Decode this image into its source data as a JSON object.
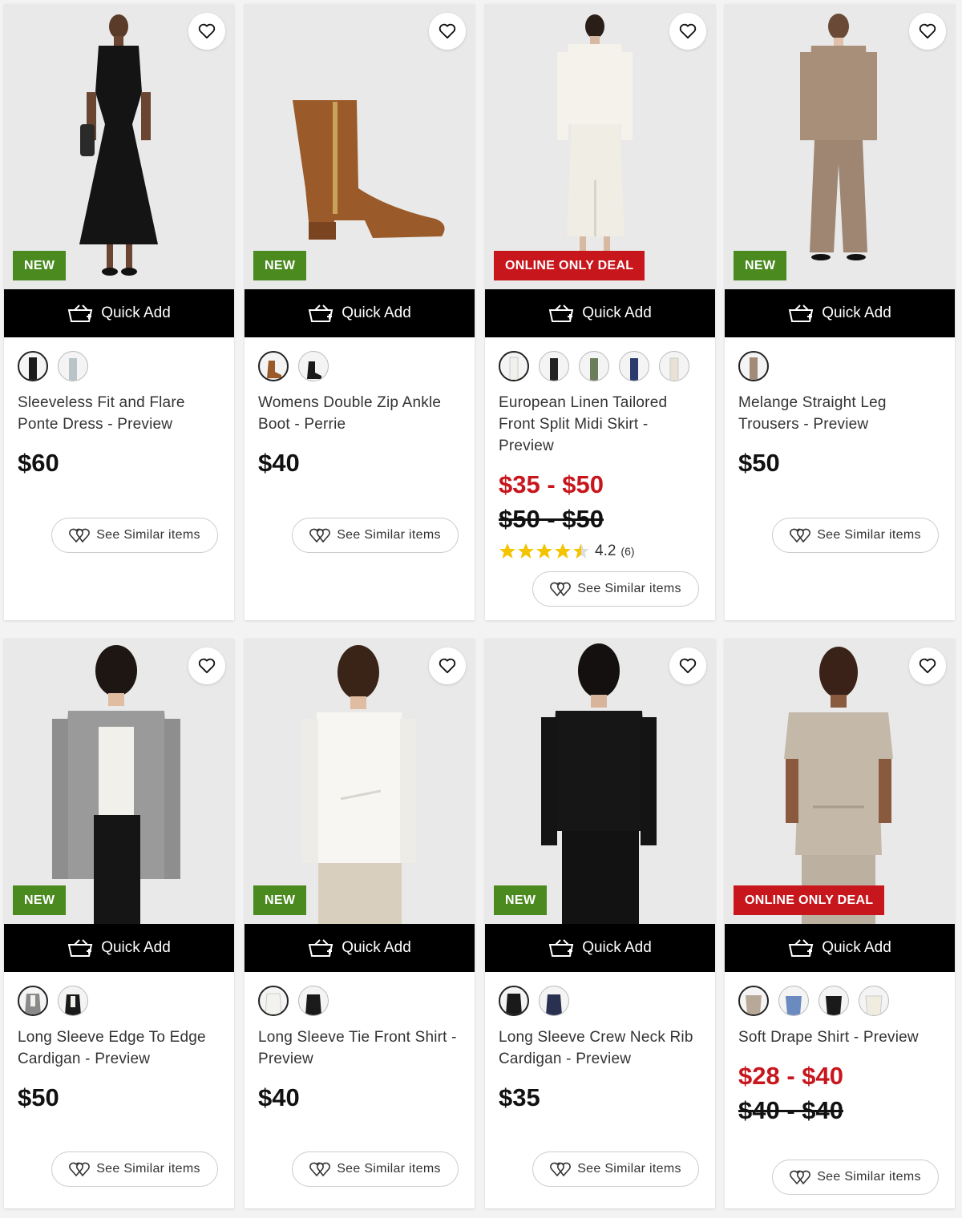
{
  "quick_add_label": "Quick Add",
  "see_similar_label": "See Similar items",
  "colors": {
    "new_badge": "#4a8a1f",
    "deal_badge": "#c8161d",
    "sale_price": "#c8161d"
  },
  "products": [
    {
      "badge": "NEW",
      "title": "Sleeveless Fit and Flare Ponte Dress - Preview",
      "price": "$60",
      "swatches": [
        "#1a1a1a",
        "#b8c4c8"
      ]
    },
    {
      "badge": "NEW",
      "title": "Womens Double Zip Ankle Boot - Perrie",
      "price": "$40",
      "swatches": [
        "#9a5a2a",
        "#1a1a1a"
      ]
    },
    {
      "badge": "ONLINE ONLY DEAL",
      "title": "European Linen Tailored Front Split Midi Skirt - Preview",
      "price": "$35 - $50",
      "was_price": "$50 - $50",
      "rating": "4.2",
      "rating_count": "(6)",
      "swatches": [
        "#f2f0ea",
        "#222222",
        "#6b7d5a",
        "#2a3a6a",
        "#e8e2d6"
      ]
    },
    {
      "badge": "NEW",
      "title": "Melange Straight Leg Trousers - Preview",
      "price": "$50",
      "swatches": [
        "#a08a78"
      ]
    },
    {
      "badge": "NEW",
      "title": "Long Sleeve Edge To Edge Cardigan - Preview",
      "price": "$50",
      "swatches": [
        "#8a8a8a",
        "#1a1a1a"
      ]
    },
    {
      "badge": "NEW",
      "title": "Long Sleeve Tie Front Shirt - Preview",
      "price": "$40",
      "swatches": [
        "#f4f2ee",
        "#1a1a1a"
      ]
    },
    {
      "badge": "NEW",
      "title": "Long Sleeve Crew Neck Rib Cardigan - Preview",
      "price": "$35",
      "swatches": [
        "#1a1a1a",
        "#2a3050"
      ]
    },
    {
      "badge": "ONLINE ONLY DEAL",
      "title": "Soft Drape Shirt - Preview",
      "price": "$28 - $40",
      "was_price": "$40 - $40",
      "swatches": [
        "#b8a898",
        "#6a8ac0",
        "#1a1a1a",
        "#f0ece0"
      ]
    }
  ]
}
